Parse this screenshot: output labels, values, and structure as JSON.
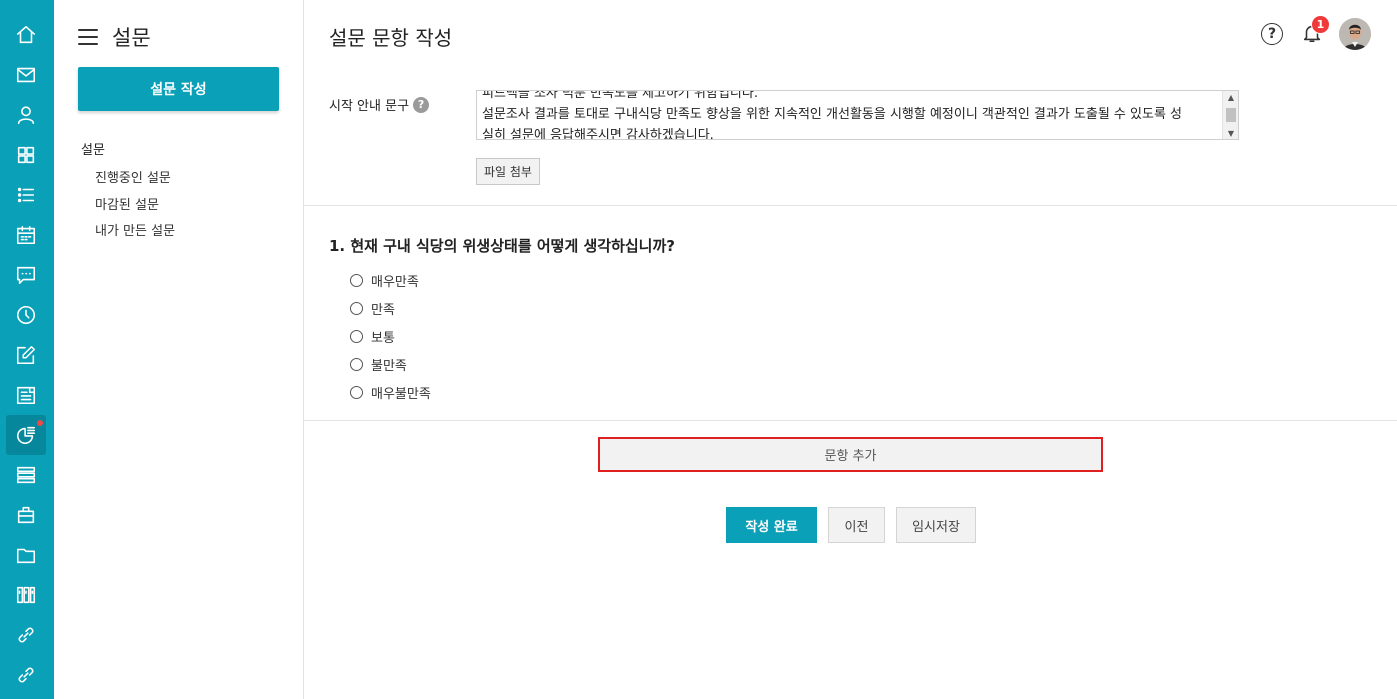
{
  "rail": {
    "items": [
      {
        "icon": "home-icon"
      },
      {
        "icon": "mail-icon"
      },
      {
        "icon": "user-icon"
      },
      {
        "icon": "grid-icon"
      },
      {
        "icon": "list-icon"
      },
      {
        "icon": "calendar-icon"
      },
      {
        "icon": "chat-icon"
      },
      {
        "icon": "clock-icon"
      },
      {
        "icon": "edit-icon"
      },
      {
        "icon": "board-icon"
      },
      {
        "icon": "survey-icon",
        "active": true,
        "has_new": true
      },
      {
        "icon": "stack-icon"
      },
      {
        "icon": "briefcase-icon"
      },
      {
        "icon": "folder-icon"
      },
      {
        "icon": "library-icon"
      },
      {
        "icon": "link-icon"
      },
      {
        "icon": "link-icon"
      }
    ]
  },
  "sidebar": {
    "title": "설문",
    "create_label": "설문 작성",
    "group_label": "설문",
    "links": [
      "진행중인 설문",
      "마감된 설문",
      "내가 만든 설문"
    ]
  },
  "header": {
    "title": "설문 문항 작성",
    "help_label": "?",
    "notification_count": "1"
  },
  "intro": {
    "label": "시작 안내 문구",
    "help_label": "?",
    "lines": [
      "피드백을 조사 덕분 만족도를 제고하기 위함입니다.",
      "설문조사 결과를 토대로 구내식당 만족도 향상을 위한 지속적인 개선활동을 시행할 예정이니 객관적인 결과가 도출될 수 있도록 성",
      "실히 설문에 응답해주시면 감사하겠습니다."
    ],
    "attach_label": "파일 첨부"
  },
  "question": {
    "title": "1. 현재 구내 식당의 위생상태를 어떻게 생각하십니까?",
    "options": [
      "매우만족",
      "만족",
      "보통",
      "불만족",
      "매우불만족"
    ]
  },
  "actions": {
    "add_label": "문항 추가",
    "done_label": "작성 완료",
    "prev_label": "이전",
    "temp_save_label": "임시저장"
  },
  "colors": {
    "accent": "#0aa0b8",
    "highlight_border": "#e02020",
    "badge": "#f03a3a"
  }
}
